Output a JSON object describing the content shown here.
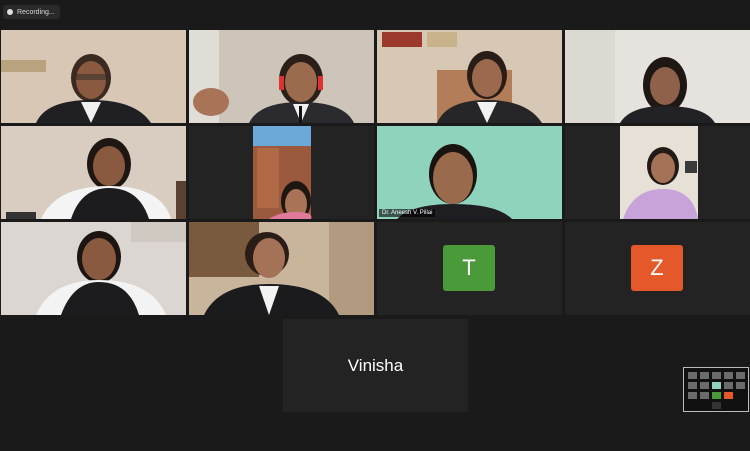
{
  "recording": {
    "label": "Recording..."
  },
  "tiles": {
    "anish": {
      "name": "Dr. Aneesh V. Pillai"
    },
    "t": {
      "initial": "T",
      "color": "#4a9a3a"
    },
    "z": {
      "initial": "Z",
      "color": "#e5582a"
    },
    "vinisha": {
      "name": "Vinisha"
    }
  },
  "colors": {
    "background": "#1a1a1a",
    "active_speaker": "#c9d43a"
  }
}
